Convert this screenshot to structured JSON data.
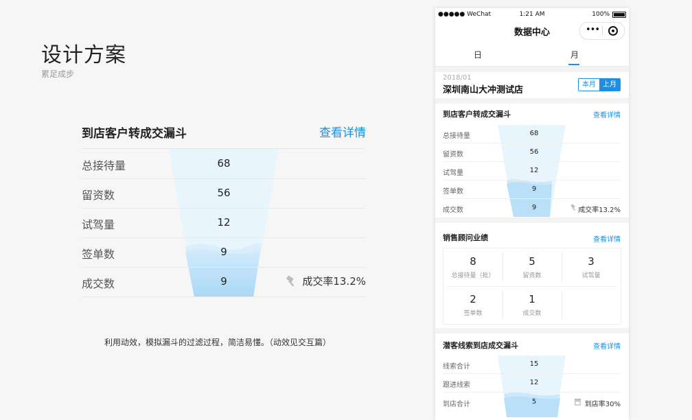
{
  "design": {
    "title": "设计方案",
    "subtitle": "累足成步",
    "caption": "利用动效，模拟漏斗的过滤过程，简洁易懂。（动效见交互篇）"
  },
  "big_funnel": {
    "title": "到店客户转成交漏斗",
    "link": "查看详情",
    "rows": [
      {
        "label": "总接待量",
        "value": "68"
      },
      {
        "label": "留资数",
        "value": "56"
      },
      {
        "label": "试驾量",
        "value": "12"
      },
      {
        "label": "签单数",
        "value": "9"
      },
      {
        "label": "成交数",
        "value": "9"
      }
    ],
    "rate": "成交率13.2%"
  },
  "phone": {
    "status": {
      "carrier": "●●●●● WeChat",
      "time": "1:21 AM",
      "battery": "100%"
    },
    "nav_title": "数据中心",
    "capsule_dots": "•••",
    "tabs": [
      "日",
      "月"
    ],
    "active_tab": "月",
    "date": "2018/01",
    "store": "深圳南山大冲测试店",
    "month_toggle": [
      "本月",
      "上月"
    ],
    "funnel1": {
      "title": "到店客户转成交漏斗",
      "link": "查看详情",
      "rows": [
        {
          "label": "总接待量",
          "value": "68"
        },
        {
          "label": "留资数",
          "value": "56"
        },
        {
          "label": "试驾量",
          "value": "12"
        },
        {
          "label": "签单数",
          "value": "9"
        },
        {
          "label": "成交数",
          "value": "9"
        }
      ],
      "rate": "成交率13.2%"
    },
    "sales": {
      "title": "销售顾问业绩",
      "link": "查看详情",
      "cells": [
        {
          "num": "8",
          "label": "总接待量（批）"
        },
        {
          "num": "5",
          "label": "留资数"
        },
        {
          "num": "3",
          "label": "试驾量"
        },
        {
          "num": "2",
          "label": "签单数"
        },
        {
          "num": "1",
          "label": "成交数"
        }
      ]
    },
    "funnel2": {
      "title": "潜客线索到店成交漏斗",
      "link": "查看详情",
      "rows": [
        {
          "label": "线索合计",
          "value": "15"
        },
        {
          "label": "跟进线索",
          "value": "12"
        },
        {
          "label": "到店合计",
          "value": "5"
        }
      ],
      "rate": "到店率30%"
    }
  },
  "colors": {
    "accent": "#1a8fe3",
    "funnel_light": "#e8f5fd",
    "funnel_water": "#b9e0f8"
  },
  "icons": [
    "hammer-icon",
    "store-icon",
    "target-icon",
    "more-dots-icon",
    "wifi-icon",
    "battery-icon"
  ]
}
